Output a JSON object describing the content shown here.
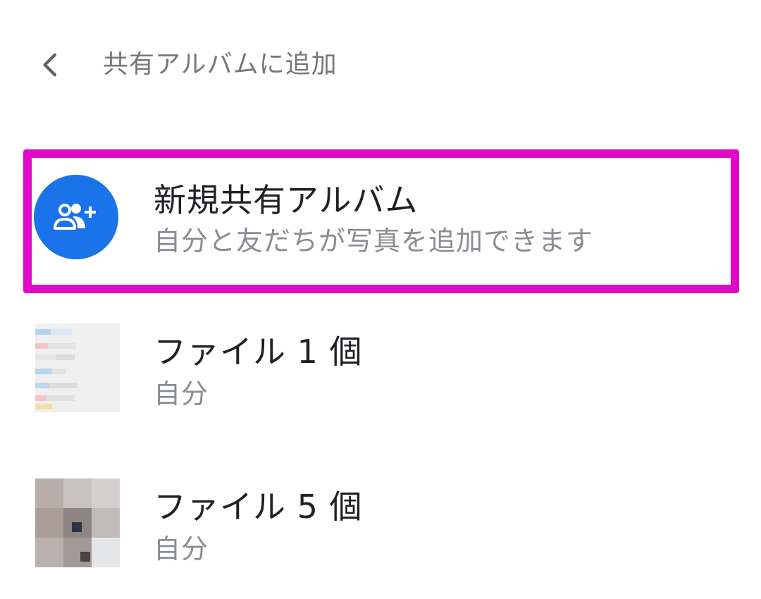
{
  "header": {
    "back_icon": "chevron-left-icon",
    "title": "共有アルバムに追加"
  },
  "new_album": {
    "icon": "group-add-icon",
    "title": "新規共有アルバム",
    "subtitle": "自分と友だちが写真を追加できます",
    "accent_color": "#1a73e8",
    "highlight_color": "#e00ac6"
  },
  "albums": [
    {
      "title": "ファイル 1 個",
      "subtitle": "自分"
    },
    {
      "title": "ファイル 5 個",
      "subtitle": "自分"
    }
  ]
}
